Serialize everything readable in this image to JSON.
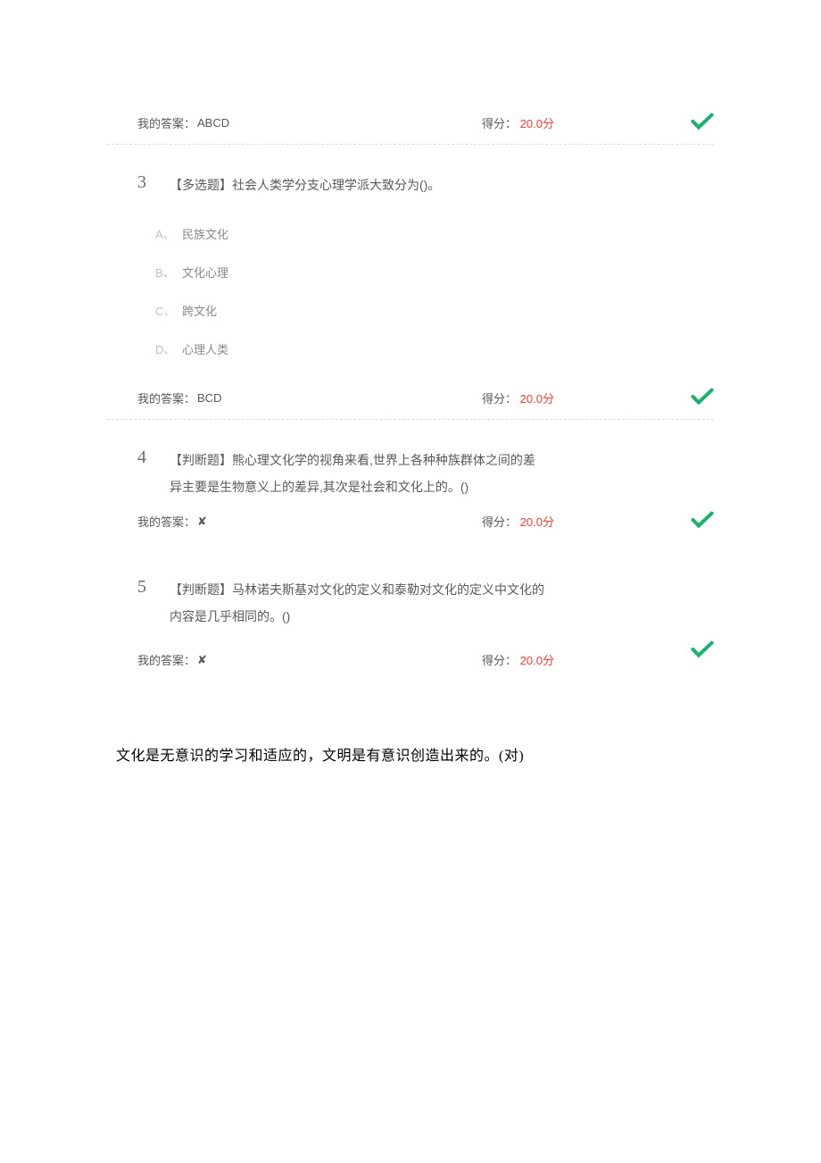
{
  "answers": {
    "myAnswerLabel": "我的答案：",
    "scoreLabel": "得分：",
    "scoreUnit": "分"
  },
  "rows": [
    {
      "val": "ABCD",
      "score": "20.0"
    },
    {
      "val": "BCD",
      "score": "20.0"
    },
    {
      "val": "✘",
      "score": "20.0"
    },
    {
      "val": "✘",
      "score": "20.0"
    }
  ],
  "q3": {
    "num": "3",
    "text": "【多选题】社会人类学分支心理学派大致分为()。",
    "options": [
      {
        "letter": "A、",
        "text": "民族文化"
      },
      {
        "letter": "B、",
        "text": "文化心理"
      },
      {
        "letter": "C、",
        "text": "跨文化"
      },
      {
        "letter": "D、",
        "text": "心理人类"
      }
    ]
  },
  "q4": {
    "num": "4",
    "text": "【判断题】熊心理文化学的视角来看,世界上各种种族群体之间的差异主要是生物意义上的差异,其次是社会和文化上的。()"
  },
  "q5": {
    "num": "5",
    "text": "【判断题】马林诺夫斯基对文化的定义和泰勒对文化的定义中文化的内容是几乎相同的。()"
  },
  "footer": "文化是无意识的学习和适应的，文明是有意识创造出来的。(对)"
}
